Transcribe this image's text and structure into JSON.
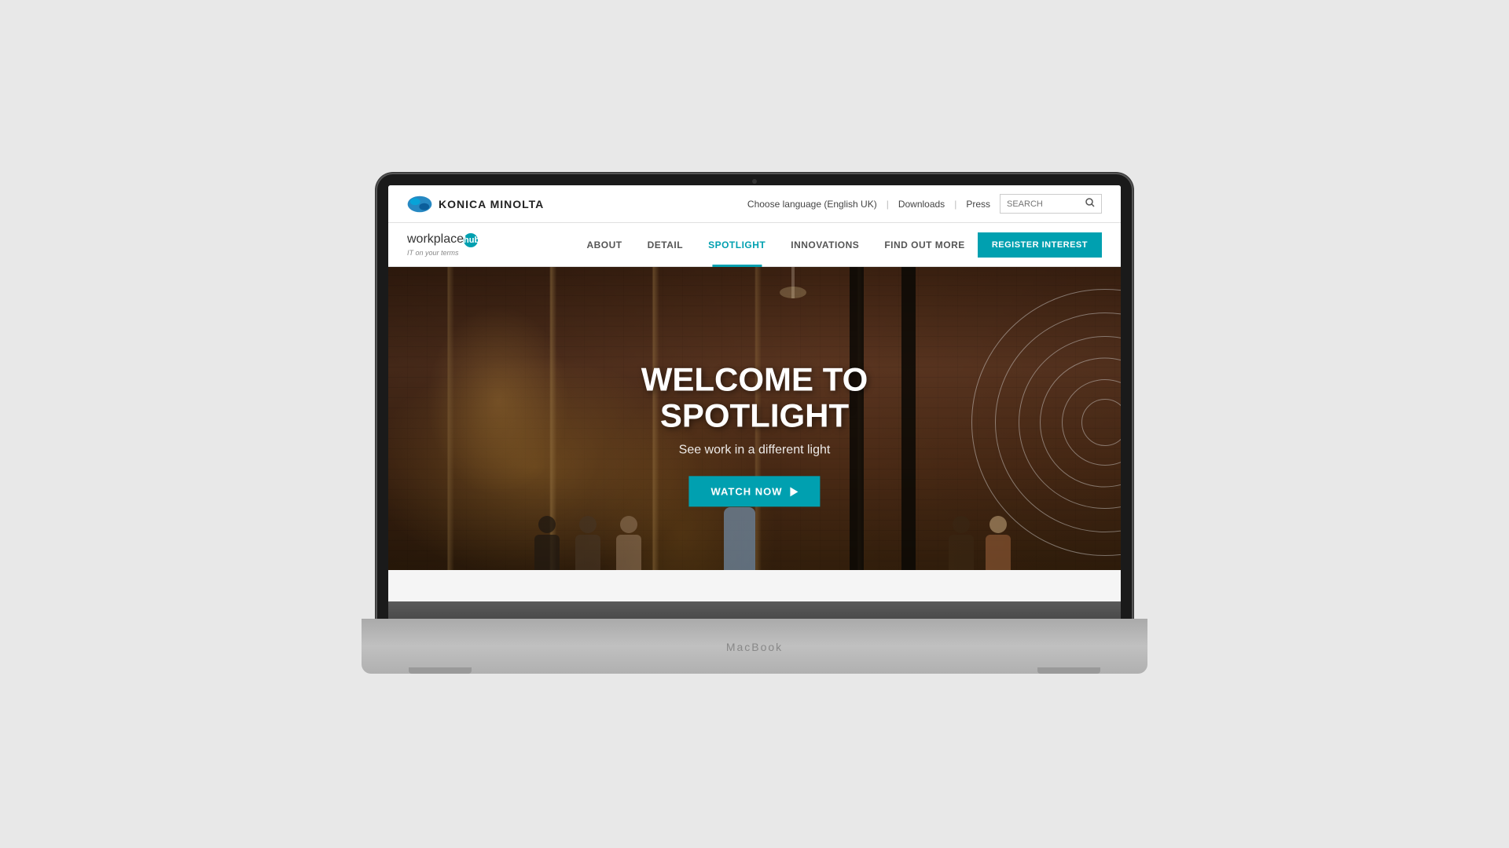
{
  "page": {
    "background": "#e8e8e8"
  },
  "topbar": {
    "logo_text": "KONICA MINOLTA",
    "language": "Choose language (English UK)",
    "downloads": "Downloads",
    "press": "Press",
    "search_placeholder": "SEARCH"
  },
  "subnav": {
    "brand_name_prefix": "workplace",
    "brand_name_hub": "hub",
    "brand_tagline": "IT on your terms",
    "nav_items": [
      {
        "label": "ABOUT",
        "active": false
      },
      {
        "label": "DETAIL",
        "active": false
      },
      {
        "label": "SPOTLIGHT",
        "active": true
      },
      {
        "label": "INNOVATIONS",
        "active": false
      },
      {
        "label": "FIND OUT MORE",
        "active": false
      }
    ],
    "register_btn": "REGISTER INTEREST"
  },
  "hero": {
    "title_line1": "WELCOME TO",
    "title_line2": "SPOTLIGHT",
    "subtitle": "See work in a different light",
    "cta_btn": "WATCH NOW"
  },
  "macbook": {
    "brand": "MacBook"
  }
}
